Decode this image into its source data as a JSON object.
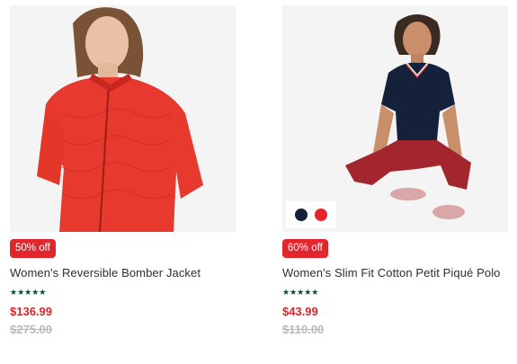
{
  "products": [
    {
      "image_alt": "Women's Reversible Bomber Jacket",
      "discount_badge": "50% off",
      "name": "Women's Reversible Bomber Jacket",
      "stars": "★★★★★",
      "sale_price": "$136.99",
      "original_price": "$275.00",
      "colors": []
    },
    {
      "image_alt": "Women's Slim Fit Cotton Petit Piqué Polo",
      "discount_badge": "60% off",
      "name": "Women's Slim Fit Cotton Petit Piqué Polo",
      "stars": "★★★★★",
      "sale_price": "$43.99",
      "original_price": "$110.00",
      "colors": [
        "#14213b",
        "#e4242a"
      ]
    }
  ]
}
